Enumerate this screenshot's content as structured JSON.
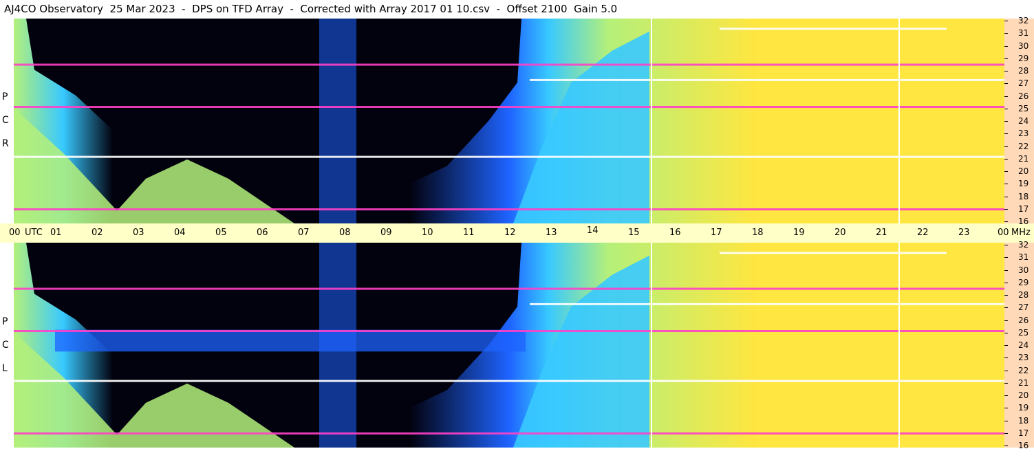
{
  "title": "AJ4CO Observatory  25 Mar 2023  -  DPS on TFD Array  -  Corrected with Array 2017 01 10.csv  -  Offset 2100  Gain 5.0",
  "panels": [
    {
      "id": "rcp",
      "polarization_letters": [
        "P",
        "C",
        "R"
      ]
    },
    {
      "id": "lcp",
      "polarization_letters": [
        "P",
        "C",
        "L"
      ]
    }
  ],
  "chart_data": {
    "type": "heatmap",
    "title": "AJ4CO Observatory  25 Mar 2023  -  DPS on TFD Array  -  Corrected with Array 2017 01 10.csv  -  Offset 2100  Gain 5.0",
    "x_axis": {
      "unit_label": "UTC",
      "range": [
        0,
        24
      ],
      "tick_labels": [
        "00",
        "01",
        "02",
        "03",
        "04",
        "05",
        "06",
        "07",
        "08",
        "09",
        "10",
        "11",
        "12",
        "13",
        "14",
        "15",
        "16",
        "17",
        "18",
        "19",
        "20",
        "21",
        "22",
        "23",
        "00"
      ]
    },
    "y_axis": {
      "unit_label": "MHz",
      "range": [
        16,
        32
      ],
      "tick_labels": [
        "32",
        "31",
        "30",
        "29",
        "28",
        "27",
        "26",
        "25",
        "24",
        "23",
        "22",
        "21",
        "20",
        "19",
        "18",
        "17",
        "16"
      ]
    },
    "colors": {
      "night": "#02020e",
      "low": "#1e63ff",
      "mid": "#38c9ff",
      "high": "#b4f07a",
      "hot": "#ffe640",
      "interference": "#ff40c8",
      "saturated": "#ffffff",
      "time_axis_bg": "#ffffc8",
      "freq_axis_bg": "#ffd9b8"
    },
    "vertical_markers_utc": [
      15.45,
      21.45
    ],
    "persistent_lines_mhz": [
      31.2,
      28.4,
      27.2,
      25.1,
      21.2,
      17.1
    ],
    "grid": false
  }
}
